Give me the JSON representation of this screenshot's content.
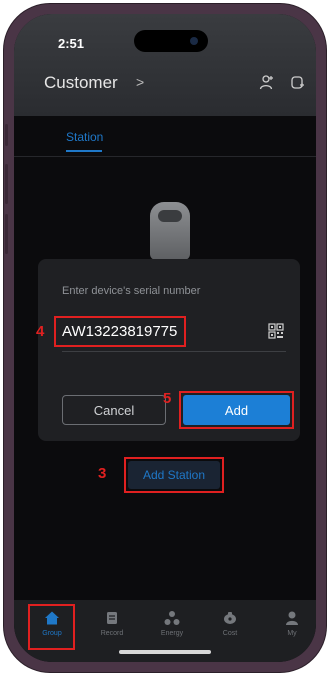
{
  "status_bar": {
    "time": "2:51"
  },
  "header": {
    "title": "Customer",
    "chevron": ">",
    "icons": [
      "add-user-icon",
      "add-group-icon"
    ]
  },
  "tabs": [
    {
      "label": "Station",
      "active": true
    }
  ],
  "dialog": {
    "prompt": "Enter device's serial number",
    "serial_value": "AW13223819775",
    "cancel_label": "Cancel",
    "add_label": "Add"
  },
  "add_station_label": "Add Station",
  "annotations": {
    "step3": "3",
    "step4": "4",
    "step5": "5"
  },
  "tabbar": [
    {
      "label": "Group",
      "icon": "home-icon",
      "active": true
    },
    {
      "label": "Record",
      "icon": "record-icon",
      "active": false
    },
    {
      "label": "Energy",
      "icon": "energy-icon",
      "active": false
    },
    {
      "label": "Cost",
      "icon": "cost-icon",
      "active": false
    },
    {
      "label": "My",
      "icon": "profile-icon",
      "active": false
    }
  ],
  "colors": {
    "accent": "#1c7fd6",
    "annotation": "#e02020",
    "background": "#0b0b0d",
    "dialog": "#1f2023"
  }
}
